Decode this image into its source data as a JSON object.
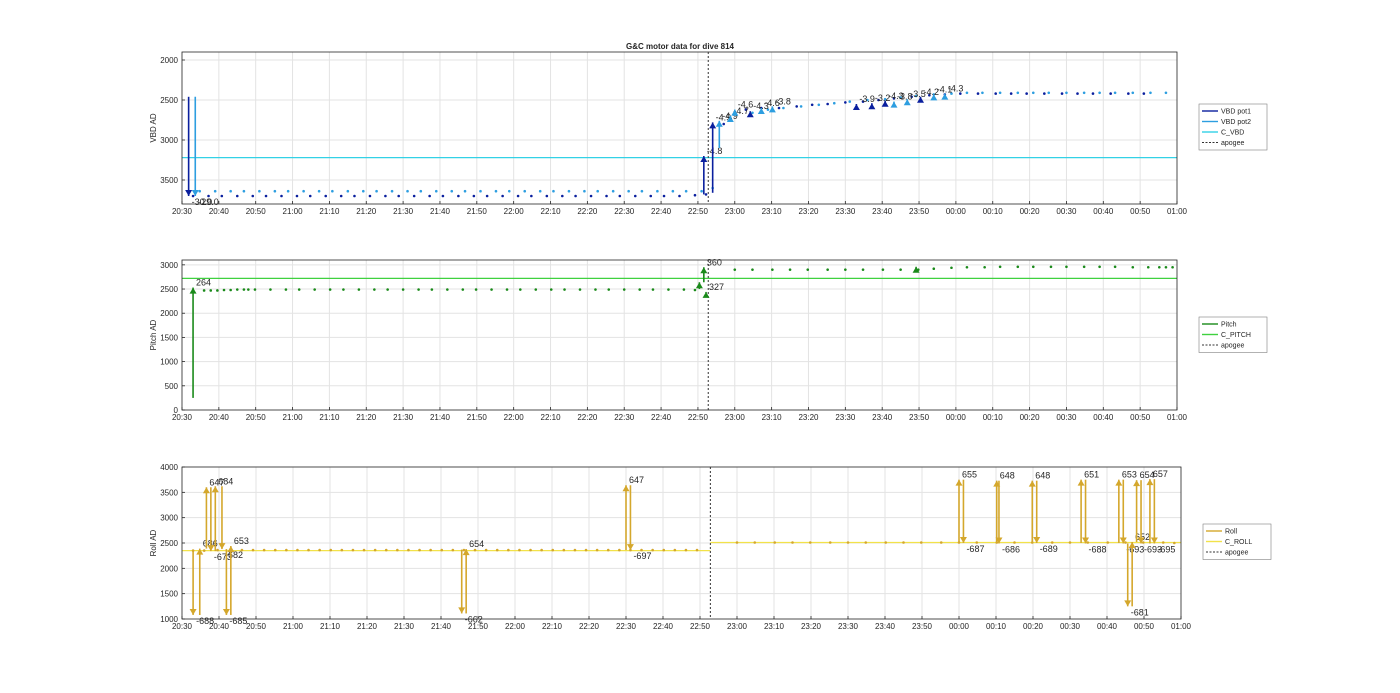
{
  "figure_title": "G&C motor data for dive 814",
  "x_ticks": [
    "20:30",
    "20:40",
    "20:50",
    "21:00",
    "21:10",
    "21:20",
    "21:30",
    "21:40",
    "21:50",
    "22:00",
    "22:10",
    "22:20",
    "22:30",
    "22:40",
    "22:50",
    "23:00",
    "23:10",
    "23:20",
    "23:30",
    "23:40",
    "23:50",
    "00:00",
    "00:10",
    "00:20",
    "00:30",
    "00:40",
    "00:50",
    "01:00"
  ],
  "apogee_x": 22.88,
  "colors": {
    "vbd_pot1": "#0a1f9e",
    "vbd_pot2": "#2d9ee0",
    "c_vbd": "#33d1e6",
    "pitch": "#1a8a1a",
    "c_pitch": "#3fd13f",
    "roll": "#d4a72c",
    "c_roll": "#f2e24a",
    "apogee": "#333333",
    "grid": "#e3e3e3",
    "axis": "#262626"
  },
  "chart_data": [
    {
      "type": "scatter",
      "ylabel": "VBD AD",
      "ylim": [
        3800,
        1900
      ],
      "y_ticks": [
        "2000",
        "2500",
        "3000",
        "3500"
      ],
      "y_tick_values": [
        2000,
        2500,
        3000,
        3500
      ],
      "xlim": [
        20.5,
        25.0
      ],
      "grid": true,
      "legend_position": "right",
      "legend": [
        "VBD pot1",
        "VBD pot2",
        "C_VBD",
        "apogee"
      ],
      "reference_line": 3220,
      "series": [
        {
          "key": "pot1",
          "x": [
            20.55,
            20.62,
            20.68,
            20.75,
            20.82,
            20.88,
            20.95,
            21.02,
            21.08,
            21.15,
            21.22,
            21.28,
            21.35,
            21.42,
            21.48,
            21.55,
            21.62,
            21.68,
            21.75,
            21.82,
            21.88,
            21.95,
            22.02,
            22.08,
            22.15,
            22.22,
            22.28,
            22.35,
            22.42,
            22.48,
            22.55,
            22.62,
            22.68,
            22.75,
            22.82,
            22.87,
            22.95,
            23.0,
            23.05,
            23.12,
            23.2,
            23.28,
            23.35,
            23.42,
            23.5,
            23.58,
            23.65,
            23.72,
            23.8,
            23.88,
            23.95,
            24.02,
            24.1,
            24.18,
            24.25,
            24.32,
            24.4,
            24.48,
            24.55,
            24.62,
            24.7,
            24.78,
            24.85
          ],
          "y": [
            3700,
            3700,
            3700,
            3700,
            3700,
            3700,
            3700,
            3700,
            3700,
            3700,
            3700,
            3700,
            3700,
            3700,
            3700,
            3700,
            3700,
            3700,
            3700,
            3700,
            3700,
            3700,
            3700,
            3700,
            3700,
            3700,
            3700,
            3700,
            3700,
            3700,
            3700,
            3700,
            3700,
            3700,
            3690,
            3680,
            2800,
            2650,
            2620,
            2600,
            2600,
            2580,
            2560,
            2550,
            2530,
            2520,
            2500,
            2480,
            2460,
            2440,
            2430,
            2420,
            2420,
            2420,
            2420,
            2420,
            2420,
            2420,
            2420,
            2420,
            2420,
            2420,
            2420
          ]
        },
        {
          "key": "pot2",
          "x": [
            20.58,
            20.65,
            20.72,
            20.78,
            20.85,
            20.92,
            20.98,
            21.05,
            21.12,
            21.18,
            21.25,
            21.32,
            21.38,
            21.45,
            21.52,
            21.58,
            21.65,
            21.72,
            21.78,
            21.85,
            21.92,
            21.98,
            22.05,
            22.12,
            22.18,
            22.25,
            22.32,
            22.38,
            22.45,
            22.52,
            22.58,
            22.65,
            22.72,
            22.78,
            22.85,
            22.9,
            22.98,
            23.08,
            23.15,
            23.22,
            23.3,
            23.38,
            23.45,
            23.52,
            23.6,
            23.68,
            23.75,
            23.82,
            23.9,
            23.98,
            24.05,
            24.12,
            24.2,
            24.28,
            24.35,
            24.42,
            24.5,
            24.58,
            24.65,
            24.72,
            24.8,
            24.88,
            24.95
          ],
          "y": [
            3640,
            3640,
            3640,
            3640,
            3640,
            3640,
            3640,
            3640,
            3640,
            3640,
            3640,
            3640,
            3640,
            3640,
            3640,
            3640,
            3640,
            3640,
            3640,
            3640,
            3640,
            3640,
            3640,
            3640,
            3640,
            3640,
            3640,
            3640,
            3640,
            3640,
            3640,
            3640,
            3640,
            3640,
            3640,
            3600,
            2720,
            2660,
            2620,
            2600,
            2580,
            2560,
            2540,
            2520,
            2500,
            2490,
            2470,
            2450,
            2430,
            2420,
            2410,
            2410,
            2410,
            2410,
            2410,
            2410,
            2410,
            2410,
            2410,
            2410,
            2410,
            2410,
            2410
          ]
        }
      ],
      "events": [
        {
          "x": 20.53,
          "from": 2460,
          "to": 3700,
          "series": "pot1",
          "label": "-30.0"
        },
        {
          "x": 20.56,
          "from": 2460,
          "to": 3700,
          "series": "pot2",
          "label": "-29.0"
        },
        {
          "x": 22.86,
          "from": 3680,
          "to": 3200,
          "series": "pot1",
          "label": "-4.8"
        },
        {
          "x": 22.9,
          "from": 3660,
          "to": 2780,
          "series": "pot1",
          "label": "-4.9"
        },
        {
          "x": 22.93,
          "from": 3100,
          "to": 2760,
          "series": "pot2",
          "label": "-4.9"
        },
        {
          "x": 22.98,
          "from": 2760,
          "to": 2700,
          "series": "pot2",
          "label": "-4.7"
        },
        {
          "x": 23.0,
          "from": 2700,
          "to": 2620,
          "series": "pot2",
          "label": "-4.6"
        },
        {
          "x": 23.07,
          "from": 2700,
          "to": 2640,
          "series": "pot1",
          "label": "-4.3"
        },
        {
          "x": 23.12,
          "from": 2640,
          "to": 2600,
          "series": "pot2",
          "label": "-4.6"
        },
        {
          "x": 23.17,
          "from": 2620,
          "to": 2580,
          "series": "pot2",
          "label": "-3.8"
        },
        {
          "x": 23.55,
          "from": 2600,
          "to": 2550,
          "series": "pot1",
          "label": "-3.9"
        },
        {
          "x": 23.62,
          "from": 2580,
          "to": 2540,
          "series": "pot1",
          "label": "-3.2"
        },
        {
          "x": 23.68,
          "from": 2560,
          "to": 2510,
          "series": "pot1",
          "label": "-4.3"
        },
        {
          "x": 23.72,
          "from": 2560,
          "to": 2520,
          "series": "pot2",
          "label": "-3.8"
        },
        {
          "x": 23.78,
          "from": 2540,
          "to": 2490,
          "series": "pot2",
          "label": "-3.5"
        },
        {
          "x": 23.84,
          "from": 2520,
          "to": 2460,
          "series": "pot1",
          "label": "-4.2"
        },
        {
          "x": 23.9,
          "from": 2500,
          "to": 2430,
          "series": "pot2",
          "label": "-4.1"
        },
        {
          "x": 23.95,
          "from": 2480,
          "to": 2420,
          "series": "pot2",
          "label": "-4.3"
        }
      ]
    },
    {
      "type": "scatter",
      "ylabel": "Pitch AD",
      "ylim": [
        0,
        3100
      ],
      "y_ticks": [
        "0",
        "500",
        "1000",
        "1500",
        "2000",
        "2500",
        "3000"
      ],
      "y_tick_values": [
        0,
        500,
        1000,
        1500,
        2000,
        2500,
        3000
      ],
      "xlim": [
        20.5,
        25.0
      ],
      "grid": true,
      "legend_position": "right",
      "legend": [
        "Pitch",
        "C_PITCH",
        "apogee"
      ],
      "reference_line": 2720,
      "series": [
        {
          "key": "pitch",
          "x": [
            20.6,
            20.63,
            20.66,
            20.69,
            20.72,
            20.75,
            20.78,
            20.8,
            20.83,
            20.9,
            20.97,
            21.03,
            21.1,
            21.17,
            21.23,
            21.3,
            21.37,
            21.43,
            21.5,
            21.57,
            21.63,
            21.7,
            21.77,
            21.83,
            21.9,
            21.97,
            22.03,
            22.1,
            22.17,
            22.23,
            22.3,
            22.37,
            22.43,
            22.5,
            22.57,
            22.63,
            22.7,
            22.77,
            22.82,
            23.0,
            23.08,
            23.17,
            23.25,
            23.33,
            23.42,
            23.5,
            23.58,
            23.67,
            23.75,
            23.83,
            23.9,
            23.98,
            24.05,
            24.13,
            24.2,
            24.28,
            24.35,
            24.43,
            24.5,
            24.58,
            24.65,
            24.72,
            24.8,
            24.87,
            24.92,
            24.95,
            24.98
          ],
          "y": [
            2470,
            2470,
            2470,
            2480,
            2480,
            2490,
            2490,
            2490,
            2490,
            2490,
            2490,
            2490,
            2490,
            2490,
            2490,
            2490,
            2490,
            2490,
            2490,
            2490,
            2490,
            2490,
            2490,
            2490,
            2490,
            2490,
            2490,
            2490,
            2490,
            2490,
            2490,
            2490,
            2490,
            2490,
            2490,
            2490,
            2490,
            2490,
            2480,
            2900,
            2900,
            2900,
            2900,
            2900,
            2900,
            2900,
            2900,
            2900,
            2900,
            2900,
            2920,
            2940,
            2950,
            2950,
            2960,
            2960,
            2960,
            2960,
            2960,
            2960,
            2960,
            2960,
            2950,
            2950,
            2950,
            2950,
            2950
          ]
        }
      ],
      "events": [
        {
          "x": 20.55,
          "from": 250,
          "to": 2530,
          "series": "pitch",
          "label": "264"
        },
        {
          "x": 22.84,
          "from": 2500,
          "to": 2640,
          "series": "pitch",
          "label": ""
        },
        {
          "x": 22.86,
          "from": 2640,
          "to": 2950,
          "series": "pitch",
          "label": "360"
        },
        {
          "x": 22.87,
          "from": 2420,
          "to": 2440,
          "series": "pitch",
          "label": "327"
        },
        {
          "x": 23.82,
          "from": 2900,
          "to": 2960,
          "series": "pitch",
          "label": ""
        }
      ]
    },
    {
      "type": "scatter",
      "ylabel": "Roll AD",
      "ylim": [
        1000,
        4000
      ],
      "y_ticks": [
        "1000",
        "1500",
        "2000",
        "2500",
        "3000",
        "3500",
        "4000"
      ],
      "y_tick_values": [
        1000,
        1500,
        2000,
        2500,
        3000,
        3500,
        4000
      ],
      "xlim": [
        20.5,
        25.0
      ],
      "grid": true,
      "legend_position": "right",
      "legend": [
        "Roll",
        "C_ROLL",
        "apogee"
      ],
      "reference_line": 2510,
      "reference_line_pre_apogee": 2350,
      "series": [
        {
          "key": "roll",
          "x": [
            20.55,
            20.6,
            20.66,
            20.72,
            20.77,
            20.82,
            20.87,
            20.92,
            20.97,
            21.02,
            21.07,
            21.12,
            21.17,
            21.22,
            21.27,
            21.32,
            21.37,
            21.42,
            21.47,
            21.52,
            21.57,
            21.62,
            21.67,
            21.72,
            21.77,
            21.82,
            21.87,
            21.92,
            21.97,
            22.02,
            22.07,
            22.12,
            22.17,
            22.22,
            22.27,
            22.32,
            22.37,
            22.42,
            22.47,
            22.52,
            22.57,
            22.62,
            22.67,
            22.72,
            22.77,
            22.82,
            23.0,
            23.08,
            23.17,
            23.25,
            23.33,
            23.42,
            23.5,
            23.58,
            23.67,
            23.75,
            23.83,
            23.92,
            24.0,
            24.08,
            24.17,
            24.25,
            24.33,
            24.42,
            24.5,
            24.58,
            24.67,
            24.75,
            24.83,
            24.92,
            24.97
          ],
          "y": [
            2350,
            2350,
            2360,
            2360,
            2360,
            2360,
            2360,
            2360,
            2360,
            2360,
            2360,
            2360,
            2360,
            2360,
            2360,
            2360,
            2360,
            2360,
            2360,
            2360,
            2360,
            2360,
            2360,
            2360,
            2360,
            2360,
            2360,
            2360,
            2360,
            2360,
            2360,
            2360,
            2360,
            2360,
            2360,
            2360,
            2360,
            2360,
            2360,
            2360,
            2360,
            2360,
            2360,
            2360,
            2360,
            2360,
            2510,
            2510,
            2510,
            2510,
            2510,
            2510,
            2510,
            2510,
            2510,
            2510,
            2510,
            2510,
            2510,
            2510,
            2510,
            2510,
            2510,
            2510,
            2510,
            2510,
            2510,
            2510,
            2510,
            2510,
            2500
          ]
        }
      ],
      "events": [
        {
          "x": 20.55,
          "from": 2350,
          "to": 1080,
          "label": "-688"
        },
        {
          "x": 20.58,
          "from": 1080,
          "to": 2390,
          "label": "686"
        },
        {
          "x": 20.61,
          "from": 2390,
          "to": 3600,
          "label": "647"
        },
        {
          "x": 20.63,
          "from": 3600,
          "to": 2340,
          "label": "-673"
        },
        {
          "x": 20.65,
          "from": 2340,
          "to": 3620,
          "label": "684"
        },
        {
          "x": 20.68,
          "from": 3620,
          "to": 2380,
          "label": "-682"
        },
        {
          "x": 20.7,
          "from": 2380,
          "to": 1080,
          "label": "-685"
        },
        {
          "x": 20.72,
          "from": 1080,
          "to": 2440,
          "label": "653"
        },
        {
          "x": 21.76,
          "from": 2370,
          "to": 1110,
          "label": "-662"
        },
        {
          "x": 21.78,
          "from": 1110,
          "to": 2380,
          "label": "654"
        },
        {
          "x": 22.5,
          "from": 2360,
          "to": 3640,
          "label": "647"
        },
        {
          "x": 22.52,
          "from": 3640,
          "to": 2360,
          "label": "-697"
        },
        {
          "x": 24.0,
          "from": 2510,
          "to": 3750,
          "label": "655"
        },
        {
          "x": 24.02,
          "from": 3750,
          "to": 2500,
          "label": "-687"
        },
        {
          "x": 24.17,
          "from": 2510,
          "to": 3730,
          "label": "648"
        },
        {
          "x": 24.18,
          "from": 3730,
          "to": 2490,
          "label": "-686"
        },
        {
          "x": 24.33,
          "from": 2500,
          "to": 3730,
          "label": "648"
        },
        {
          "x": 24.35,
          "from": 3730,
          "to": 2500,
          "label": "-689"
        },
        {
          "x": 24.55,
          "from": 2500,
          "to": 3750,
          "label": "651"
        },
        {
          "x": 24.57,
          "from": 3750,
          "to": 2490,
          "label": "-688"
        },
        {
          "x": 24.72,
          "from": 2500,
          "to": 3750,
          "label": "653"
        },
        {
          "x": 24.74,
          "from": 3750,
          "to": 2490,
          "label": "-693"
        },
        {
          "x": 24.76,
          "from": 2490,
          "to": 1250,
          "label": "-681"
        },
        {
          "x": 24.78,
          "from": 1250,
          "to": 2520,
          "label": "652"
        },
        {
          "x": 24.8,
          "from": 2520,
          "to": 3740,
          "label": "654"
        },
        {
          "x": 24.82,
          "from": 3740,
          "to": 2490,
          "label": "-693"
        },
        {
          "x": 24.86,
          "from": 2490,
          "to": 3760,
          "label": "657"
        },
        {
          "x": 24.88,
          "from": 3760,
          "to": 2490,
          "label": "-695"
        }
      ]
    }
  ]
}
